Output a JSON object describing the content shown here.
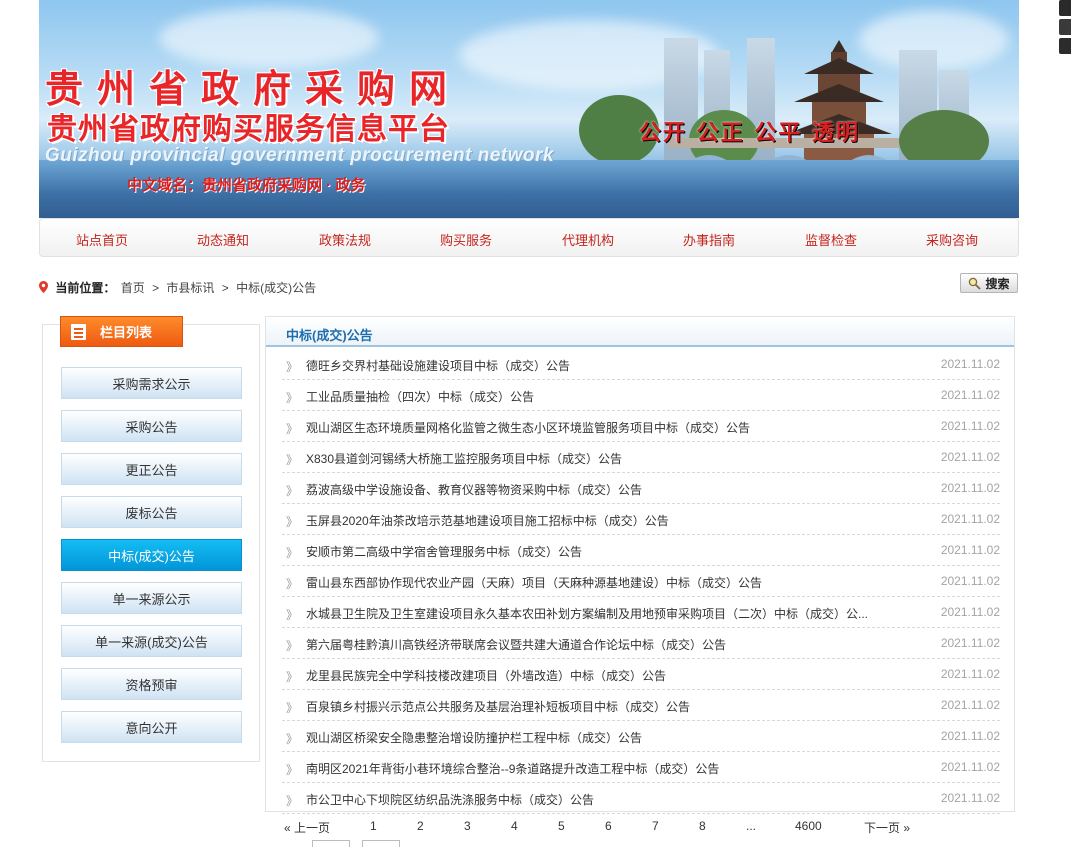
{
  "banner": {
    "title": "贵州省政府采购网",
    "subtitle": "贵州省政府购买服务信息平台",
    "english": "Guizhou provincial government procurement network",
    "domain": "中文域名：贵州省政府采购网 · 政务",
    "slogan": "公开 公正 公平 透明"
  },
  "nav": [
    "站点首页",
    "动态通知",
    "政策法规",
    "购买服务",
    "代理机构",
    "办事指南",
    "监督检查",
    "采购咨询"
  ],
  "breadcrumb": {
    "label": "当前位置：",
    "items": [
      "首页",
      "市县标讯",
      "中标(成交)公告"
    ],
    "sep": ">"
  },
  "search": {
    "label": "搜索"
  },
  "sidebar": {
    "heading": "栏目列表",
    "items": [
      "采购需求公示",
      "采购公告",
      "更正公告",
      "废标公告",
      "中标(成交)公告",
      "单一来源公示",
      "单一来源(成交)公告",
      "资格预审",
      "意向公开"
    ],
    "active_index": 4
  },
  "main": {
    "heading": "中标(成交)公告",
    "rows": [
      {
        "text": "德旺乡交界村基础设施建设项目中标（成交）公告",
        "date": "2021.11.02"
      },
      {
        "text": "工业品质量抽检（四次）中标（成交）公告",
        "date": "2021.11.02"
      },
      {
        "text": "观山湖区生态环境质量网格化监管之微生态小区环境监管服务项目中标（成交）公告",
        "date": "2021.11.02"
      },
      {
        "text": "X830县道剑河锡绣大桥施工监控服务项目中标（成交）公告",
        "date": "2021.11.02"
      },
      {
        "text": "荔波高级中学设施设备、教育仪器等物资采购中标（成交）公告",
        "date": "2021.11.02"
      },
      {
        "text": "玉屏县2020年油茶改培示范基地建设项目施工招标中标（成交）公告",
        "date": "2021.11.02"
      },
      {
        "text": "安顺市第二高级中学宿舍管理服务中标（成交）公告",
        "date": "2021.11.02"
      },
      {
        "text": "雷山县东西部协作现代农业产园（天麻）项目（天麻种源基地建设）中标（成交）公告",
        "date": "2021.11.02"
      },
      {
        "text": "水城县卫生院及卫生室建设项目永久基本农田补划方案编制及用地预审采购项目（二次）中标（成交）公...",
        "date": "2021.11.02"
      },
      {
        "text": "第六届粤桂黔滇川高铁经济带联席会议暨共建大通道合作论坛中标（成交）公告",
        "date": "2021.11.02"
      },
      {
        "text": "龙里县民族完全中学科技楼改建项目（外墙改造）中标（成交）公告",
        "date": "2021.11.02"
      },
      {
        "text": "百泉镇乡村振兴示范点公共服务及基层治理补短板项目中标（成交）公告",
        "date": "2021.11.02"
      },
      {
        "text": "观山湖区桥梁安全隐患整治增设防撞护栏工程中标（成交）公告",
        "date": "2021.11.02"
      },
      {
        "text": "南明区2021年背街小巷环境综合整治--9条道路提升改造工程中标（成交）公告",
        "date": "2021.11.02"
      },
      {
        "text": "市公卫中心下坝院区纺织品洗涤服务中标（成交）公告",
        "date": "2021.11.02"
      }
    ]
  },
  "pager": {
    "prev": "« 上一页",
    "pages": [
      "1",
      "2",
      "3",
      "4",
      "5",
      "6",
      "7",
      "8",
      "...",
      "4600"
    ],
    "next": "下一页 »"
  },
  "colors": {
    "brand_red": "#e8262a",
    "nav_text": "#c4251d",
    "active_blue": "#0295d8",
    "heading_blue": "#1d6fad",
    "sidebar_orange": "#ee5a11"
  },
  "icons": {
    "location": "map-pin-icon",
    "search": "magnifier-icon",
    "list": "document-icon",
    "row_bullet": "double-chevron-icon"
  }
}
